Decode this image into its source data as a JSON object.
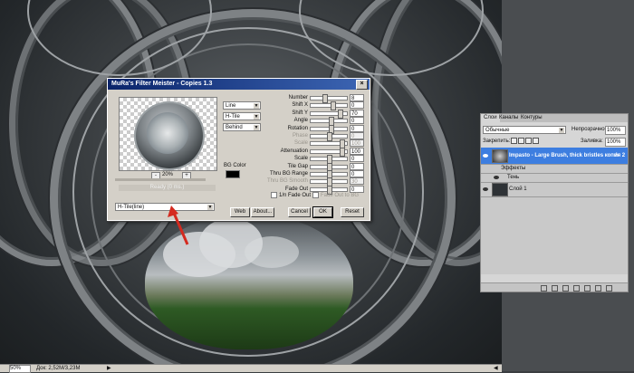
{
  "dialog": {
    "title": "MuRa's Filter Meister - Copies 1.3",
    "close_glyph": "×",
    "zoom_minus": "-",
    "zoom_plus": "+",
    "zoom": "20%",
    "status": "Ready  (0 ms.)",
    "dropdowns": {
      "mode": "Line",
      "tile": "H-Tile",
      "order": "Behind",
      "preset": "H-Tile(line)"
    },
    "params": [
      {
        "label": "Number",
        "value": "8",
        "dim": false
      },
      {
        "label": "Shift X",
        "value": "0",
        "dim": false
      },
      {
        "label": "Shift Y",
        "value": "70",
        "dim": false
      },
      {
        "label": "Angle",
        "value": "0",
        "dim": false
      },
      {
        "label": "Rotation",
        "value": "0",
        "dim": false
      },
      {
        "label": "Phase",
        "value": "0",
        "dim": true
      },
      {
        "label": "Scale",
        "value": "100",
        "dim": true
      },
      {
        "label": "Attenuation",
        "value": "100",
        "dim": false
      },
      {
        "label": "Scale",
        "value": "0",
        "dim": false
      },
      {
        "label": "Tile Gap",
        "value": "0",
        "dim": false
      },
      {
        "label": "Thru BG Range",
        "value": "0",
        "dim": false
      },
      {
        "label": "Thru BG Smooth",
        "value": "30",
        "dim": true
      },
      {
        "label": "Fade Out",
        "value": "0",
        "dim": false
      }
    ],
    "bg_color_label": "BG Color",
    "bg_color": "#000000",
    "checkbox_fade": "1/n Fade Out",
    "checkbox_fade_bg": "Fade Out to BG",
    "buttons": {
      "web": "Web",
      "about": "About...",
      "cancel": "Cancel",
      "ok": "OK",
      "reset": "Reset"
    }
  },
  "layers_panel": {
    "tabs": [
      "Слои",
      "Каналы",
      "Контуры"
    ],
    "blend_mode": "Обычные",
    "opacity_label": "Непрозрачность:",
    "opacity": "100%",
    "lock_label": "Закрепить:",
    "fill_label": "Заливка:",
    "fill": "100%",
    "fx_glyph": "fx",
    "layers": [
      {
        "name": "Impasto - Large Brush, thick bristles копия 2",
        "selected": true
      },
      {
        "name": "Эффекты",
        "selected": false
      },
      {
        "name": "Тень",
        "selected": false
      },
      {
        "name": "Слой 1",
        "selected": false
      }
    ]
  },
  "status_bar": {
    "zoom": "50%",
    "doc": "Док: 2,52M/3,23M",
    "nav_left": "▶",
    "nav_right": "◀"
  },
  "colors": {
    "title_bar": "#0a246a",
    "selected_layer": "#3d7ee0",
    "arrow": "#d42a1f"
  }
}
